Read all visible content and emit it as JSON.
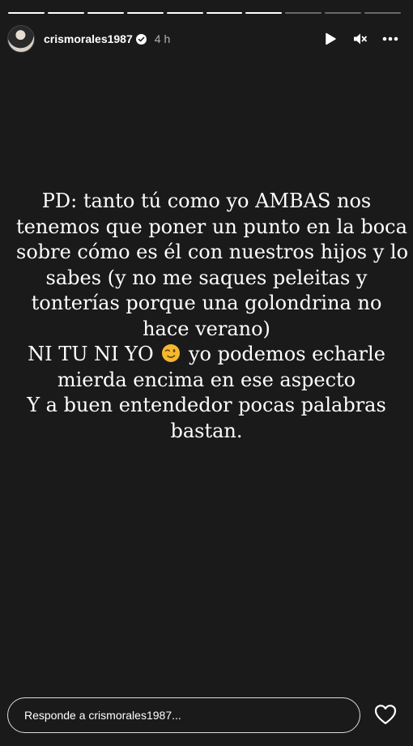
{
  "story": {
    "progress_total": 10,
    "progress_completed": 7
  },
  "header": {
    "username": "crismorales1987",
    "time_ago": "4 h",
    "verified_icon": "verified-badge-icon",
    "play_icon": "play-icon",
    "mute_icon": "muted-speaker-icon",
    "more_icon": "more-horizontal-icon"
  },
  "caption": {
    "lines": [
      "PD: tanto tú como yo AMBAS nos",
      "tenemos que poner un punto en la boca",
      "sobre cómo es él con nuestros hijos y lo",
      "sabes (y no me saques peleitas y",
      "tonterías porque una golondrina no",
      "hace verano)",
      "NI TU NI YO",
      "yo podemos echarle",
      "mierda encima en ese aspecto",
      "Y a buen entendedor pocas palabras",
      "bastan."
    ],
    "emoji": "winking-face-emoji"
  },
  "footer": {
    "reply_placeholder": "Responde a crismorales1987...",
    "like_icon": "heart-icon"
  },
  "colors": {
    "background": "#1a1a1a",
    "text": "#ffffff",
    "emoji": "#f5b82e"
  }
}
